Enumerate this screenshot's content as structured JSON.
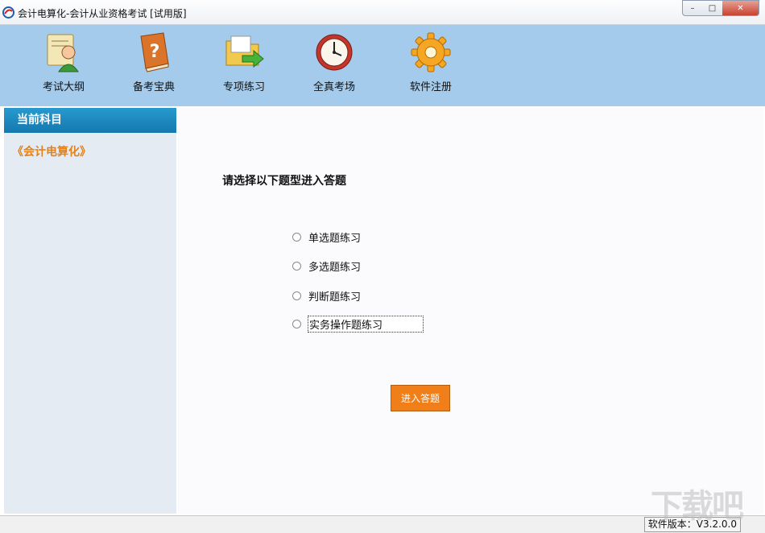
{
  "window": {
    "title": "会计电算化-会计从业资格考试 [试用版]",
    "controls": {
      "minimize": "–",
      "maximize": "□",
      "close": "✕"
    }
  },
  "toolbar": {
    "items": [
      {
        "label": "考试大纲",
        "icon": "teacher-icon"
      },
      {
        "label": "备考宝典",
        "icon": "question-book-icon"
      },
      {
        "label": "专项练习",
        "icon": "folder-arrow-icon"
      },
      {
        "label": "全真考场",
        "icon": "clock-icon"
      },
      {
        "label": "软件注册",
        "icon": "gear-icon"
      }
    ]
  },
  "sidebar": {
    "header": "当前科目",
    "subject": "《会计电算化》"
  },
  "main": {
    "prompt": "请选择以下题型进入答题",
    "options": [
      {
        "label": "单选题练习",
        "selected": false
      },
      {
        "label": "多选题练习",
        "selected": false
      },
      {
        "label": "判断题练习",
        "selected": false
      },
      {
        "label": "实务操作题练习",
        "selected": false,
        "focused": true
      }
    ],
    "submit": "进入答题"
  },
  "status": {
    "version": "软件版本：V3.2.0.0"
  },
  "watermark": "下载吧",
  "colors": {
    "toolbar_bg": "#a4cbeb",
    "sidebar_header": "#1a86bf",
    "subject_text": "#e2821c",
    "submit_bg": "#f07f1a"
  }
}
